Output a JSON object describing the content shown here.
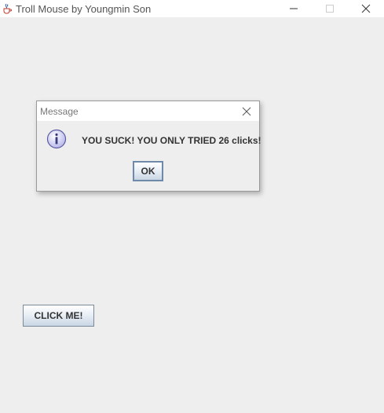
{
  "window": {
    "title": "Troll Mouse by Youngmin Son",
    "app_icon": "java-cup-icon",
    "controls": [
      "minimize-icon",
      "maximize-icon",
      "close-icon"
    ]
  },
  "main": {
    "click_button_label": "CLICK ME!"
  },
  "dialog": {
    "title": "Message",
    "icon": "info-icon",
    "message": "YOU SUCK! YOU ONLY TRIED 26 clicks!",
    "ok_label": "OK"
  },
  "colors": {
    "window_bg": "#eeeeee",
    "titlebar_bg": "#ffffff",
    "button_border": "#7a8a99",
    "info_icon_fill": "#c9c9f0",
    "info_icon_stroke": "#5a5aa0"
  }
}
